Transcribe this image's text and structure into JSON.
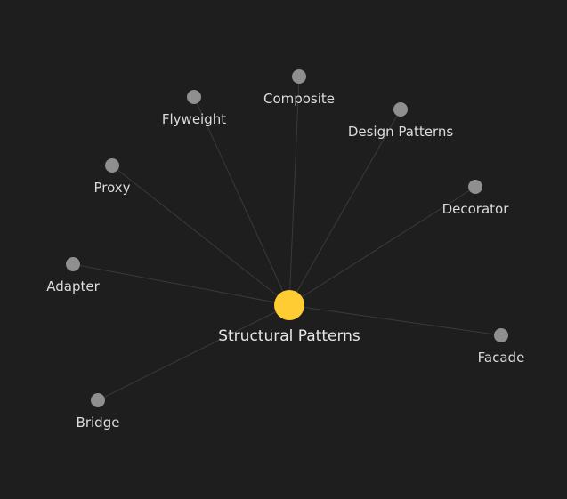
{
  "graph": {
    "center": {
      "label": "Structural Patterns",
      "color": "#ffcc33"
    },
    "node_color": "#8f8f8f",
    "edge_color": "#3a3a3a",
    "background": "#1e1e1e",
    "nodes": [
      {
        "id": "composite",
        "label": "Composite"
      },
      {
        "id": "flyweight",
        "label": "Flyweight"
      },
      {
        "id": "design-patterns",
        "label": "Design Patterns"
      },
      {
        "id": "proxy",
        "label": "Proxy"
      },
      {
        "id": "decorator",
        "label": "Decorator"
      },
      {
        "id": "adapter",
        "label": "Adapter"
      },
      {
        "id": "facade",
        "label": "Facade"
      },
      {
        "id": "bridge",
        "label": "Bridge"
      }
    ]
  }
}
